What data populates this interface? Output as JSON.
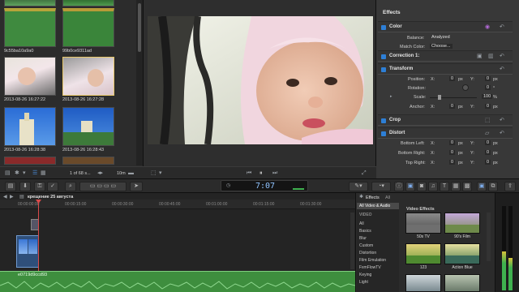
{
  "browser": {
    "clips": [
      {
        "label": "06baa42eb717",
        "thumb": "green-bar"
      },
      {
        "label": "",
        "thumb": "green-bar-2"
      },
      {
        "label": "9c55ba10a9a0",
        "thumb": "green-bar-3"
      },
      {
        "label": "99b0ce9311ad",
        "thumb": "green-bar-4"
      },
      {
        "label": "2013-08-26 16:27:22",
        "thumb": "baby"
      },
      {
        "label": "2013-08-26 16:27:28",
        "thumb": "baby-2"
      },
      {
        "label": "2013-08-26 16:28:38",
        "thumb": "church"
      },
      {
        "label": "2013-08-26 16:28:43",
        "thumb": "church-2"
      }
    ],
    "status_text": "1 of 68 s...",
    "duration_text": "10m"
  },
  "inspector": {
    "title": "Effects",
    "sections": {
      "color": "Color",
      "correction": "Correction 1:",
      "transform": "Transform",
      "crop": "Crop",
      "distort": "Distort"
    },
    "color_props": {
      "balance_label": "Balance:",
      "balance_value": "Analyzed",
      "match_label": "Match Color:",
      "match_value": "Choose..."
    },
    "transform_props": {
      "position_label": "Position:",
      "x": "X:",
      "x_val": "0",
      "px": "px",
      "y": "Y:",
      "y_val": "0",
      "rotation_label": "Rotation:",
      "rotation_val": "0",
      "deg": "°",
      "scale_label": "Scale:",
      "scale_val": "100",
      "pct": "%",
      "anchor_label": "Anchor:",
      "anchor_x": "0",
      "anchor_y": "0"
    },
    "distort_props": {
      "bottom_left": "Bottom Left:",
      "bottom_right": "Bottom Right:",
      "top_right": "Top Right:",
      "val": "0",
      "px": "px"
    }
  },
  "timecode": {
    "value": "7:07"
  },
  "timeline": {
    "project_name": "крещение 25 августа",
    "clip_label": "e0719d9ccd93",
    "ruler_ticks": [
      "00:00:00:00",
      "00:00:15:00",
      "00:00:30:00",
      "00:00:45:00",
      "00:01:00:00",
      "00:01:15:00",
      "00:01:30:00"
    ]
  },
  "effects": {
    "title": "Effects",
    "all_label": "All",
    "category_header": "All Video & Audio",
    "video_header": "VIDEO",
    "categories": [
      "All",
      "Basics",
      "Blur",
      "Custom",
      "Distortion",
      "Film Emulation",
      "FxmFlowTV",
      "Keying",
      "Light"
    ],
    "group_title": "Video Effects",
    "tiles": [
      {
        "name": "50s TV"
      },
      {
        "name": "90's Film"
      },
      {
        "name": "123"
      },
      {
        "name": "Action Blue"
      }
    ]
  },
  "colors": {
    "accent_blue": "#2d7fd6",
    "clip_green": "#3e8e3e",
    "playhead": "#d94a4a"
  }
}
